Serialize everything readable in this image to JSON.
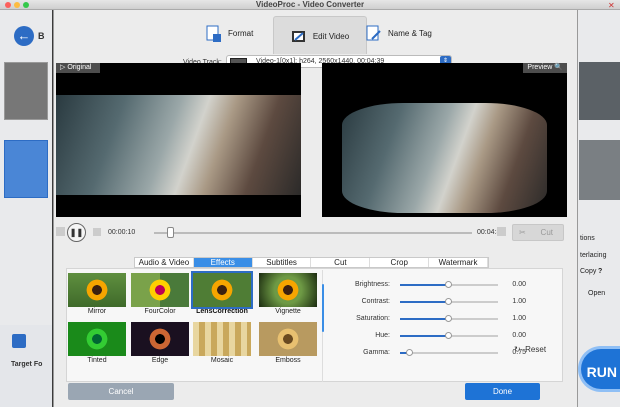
{
  "app": {
    "title": "VideoProc - Video Converter",
    "accent": "#1e73d6"
  },
  "background": {
    "back_label": "B",
    "target_format_label": "Target Fo",
    "run_label": "RUN",
    "right_texts": [
      "tions",
      "terlacing",
      "Copy",
      "?",
      "Open"
    ]
  },
  "tabs": [
    {
      "label": "Format",
      "icon": "format-icon"
    },
    {
      "label": "Edit Video",
      "icon": "edit-video-icon"
    },
    {
      "label": "Name & Tag",
      "icon": "name-tag-icon"
    }
  ],
  "video_track": {
    "label": "Video Track:",
    "value": "Video-1[0x1]: h264, 2560x1440, 00:04:39"
  },
  "panes": {
    "original": "Original",
    "preview": "Preview"
  },
  "playback": {
    "current_time": "00:00:10",
    "end_time": "00:04:39",
    "cut_label": "Cut",
    "progress": 0.04
  },
  "subtabs": [
    "Audio & Video",
    "Effects",
    "Subtitles",
    "Cut",
    "Crop",
    "Watermark"
  ],
  "active_subtab": "Effects",
  "effects": [
    {
      "label": "Mirror"
    },
    {
      "label": "FourColor"
    },
    {
      "label": "LensCorrection"
    },
    {
      "label": "Vignette"
    },
    {
      "label": "Tinted"
    },
    {
      "label": "Edge"
    },
    {
      "label": "Mosaic"
    },
    {
      "label": "Emboss"
    }
  ],
  "adjustments": [
    {
      "label": "Brightness:",
      "value": "0.00",
      "fraction": 0.5
    },
    {
      "label": "Contrast:",
      "value": "1.00",
      "fraction": 0.5
    },
    {
      "label": "Saturation:",
      "value": "1.00",
      "fraction": 0.5
    },
    {
      "label": "Hue:",
      "value": "0.00",
      "fraction": 0.5
    },
    {
      "label": "Gamma:",
      "value": "0.75",
      "fraction": 0.1
    }
  ],
  "reset_label": "Reset",
  "buttons": {
    "cancel": "Cancel",
    "done": "Done"
  }
}
